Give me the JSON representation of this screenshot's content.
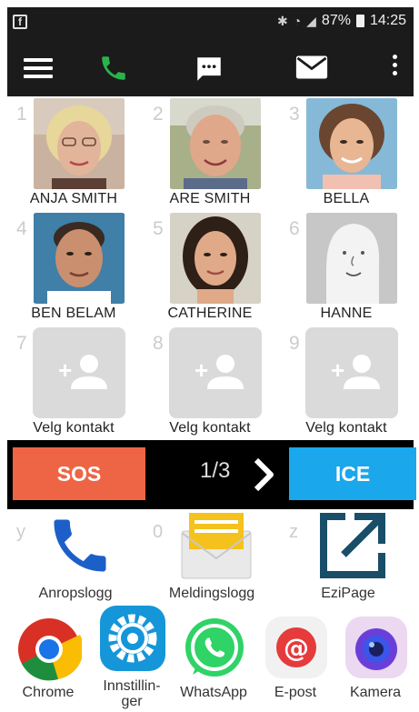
{
  "status_bar": {
    "battery": "87%",
    "time": "14:25",
    "notification_icon": "facebook-icon"
  },
  "toolbar": {
    "icons": [
      "menu-icon",
      "phone-icon",
      "message-icon",
      "mail-icon",
      "more-vert-icon"
    ],
    "phone_color": "#2ab24b"
  },
  "contacts": [
    {
      "num": "1",
      "name": "ANJA SMITH"
    },
    {
      "num": "2",
      "name": "ARE SMITH"
    },
    {
      "num": "3",
      "name": "BELLA"
    },
    {
      "num": "4",
      "name": "BEN BELAM"
    },
    {
      "num": "5",
      "name": "CATHERINE"
    },
    {
      "num": "6",
      "name": "HANNE"
    },
    {
      "num": "7",
      "name": "Velg kontakt"
    },
    {
      "num": "8",
      "name": "Velg kontakt"
    },
    {
      "num": "9",
      "name": "Velg kontakt"
    }
  ],
  "actions": {
    "sos_label": "SOS",
    "page": "1/3",
    "ice_label": "ICE"
  },
  "shortcuts": [
    {
      "key": "y",
      "label": "Anropslogg"
    },
    {
      "key": "0",
      "label": "Meldingslogg"
    },
    {
      "key": "z",
      "label": "EziPage"
    }
  ],
  "dock": [
    {
      "label": "Chrome"
    },
    {
      "label": "Innstillin-\nger"
    },
    {
      "label": "WhatsApp"
    },
    {
      "label": "E-post"
    },
    {
      "label": "Kamera"
    }
  ]
}
